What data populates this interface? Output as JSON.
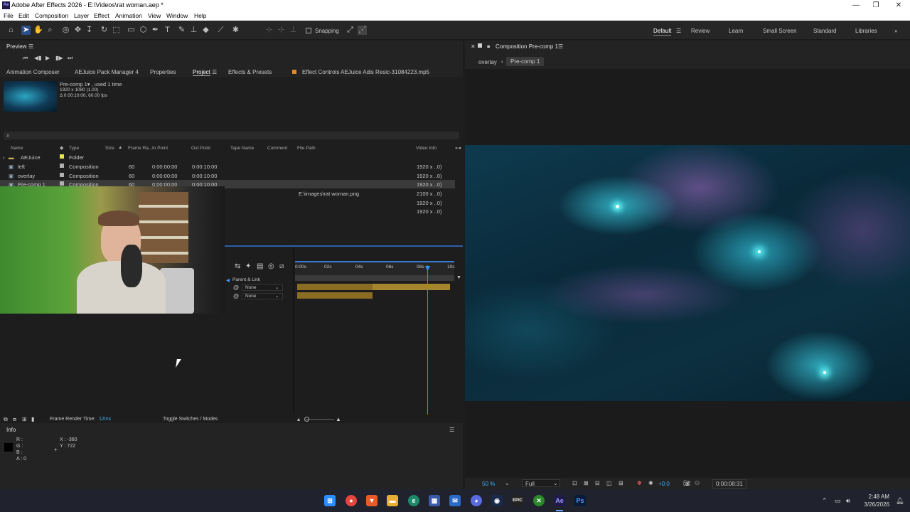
{
  "app": {
    "title": "Adobe After Effects 2026 - E:\\Videos\\rat woman.aep *",
    "logo": "Ae"
  },
  "menu": [
    "File",
    "Edit",
    "Composition",
    "Layer",
    "Effect",
    "Animation",
    "View",
    "Window",
    "Help"
  ],
  "toolbar": {
    "snapping_label": "Snapping"
  },
  "workspaces": {
    "default": "Default",
    "review": "Review",
    "learn": "Learn",
    "small_screen": "Small Screen",
    "standard": "Standard",
    "libraries": "Libraries"
  },
  "preview": {
    "title": "Preview"
  },
  "panel_tabs": {
    "animation_composer": "Animation Composer",
    "aejuice": "AEJuice Pack Manager 4",
    "properties": "Properties",
    "project": "Project",
    "effects": "Effects & Presets",
    "effect_controls": "Effect Controls AEJuice Adis Resic-31084223.mp5"
  },
  "project": {
    "selected_name": "Pre-comp 1▾ , used 1 time",
    "selected_size": "1920 x 1080 (1.00)",
    "selected_duration": "Δ 0:00:10:00, 60.00 fps",
    "search_icon": "search-icon",
    "columns": {
      "name": "Name",
      "type": "Type",
      "size": "Size",
      "frame_rate": "Frame Ra...",
      "in_point": "In Point",
      "out_point": "Out Point",
      "tape_name": "Tape Name",
      "comment": "Comment",
      "file_path": "File Path",
      "video_info": "Video Info"
    },
    "rows": [
      {
        "name": "AEJuice",
        "type": "Folder",
        "fps": "",
        "in": "",
        "out": "",
        "path": "",
        "video": "",
        "color": "#e6e64a"
      },
      {
        "name": "left",
        "type": "Composition",
        "fps": "60",
        "in": "0:00:00:00",
        "out": "0:00:10:00",
        "path": "",
        "video": "1920 x ..0)",
        "color": "#b0b0b0"
      },
      {
        "name": "overlay",
        "type": "Composition",
        "fps": "60",
        "in": "0:00:00:00",
        "out": "0:00:10:00",
        "path": "",
        "video": "1920 x ..0)",
        "color": "#b0b0b0"
      },
      {
        "name": "Pre-comp 1",
        "type": "Composition",
        "fps": "60",
        "in": "0:00:00:00",
        "out": "0:00:10:00",
        "path": "",
        "video": "1920 x ..0)",
        "color": "#b0b0b0"
      },
      {
        "name": "",
        "type": "",
        "fps": "",
        "in": "",
        "out": "",
        "path": "E:\\images\\rat woman.png",
        "video": "2100 x ..0)",
        "color": ""
      },
      {
        "name": "",
        "type": "",
        "fps": "",
        "in": "",
        "out": "",
        "path": "",
        "video": "1920 x ..0)",
        "color": ""
      },
      {
        "name": "",
        "type": "",
        "fps": "",
        "in": "",
        "out": "",
        "path": "",
        "video": "1920 x ..0)",
        "color": ""
      }
    ]
  },
  "timeline": {
    "ruler": [
      "0:00s",
      "02s",
      "04s",
      "06s",
      "08s",
      "10s"
    ],
    "parent_link": "Parent & Link",
    "layer_parents": [
      "None",
      "None"
    ],
    "frame_render_label": "Frame Render Time:",
    "frame_render_value": "12ms",
    "toggle_label": "Toggle Switches / Modes",
    "playhead_fraction": 0.86
  },
  "comp": {
    "tab": "Composition Pre-comp 1",
    "breadcrumb_parent": "overlay",
    "breadcrumb_current": "Pre-comp 1",
    "zoom": "50 %",
    "resolution": "Full",
    "exposure": "+0.0",
    "timecode": "0:00:08:31"
  },
  "info": {
    "title": "Info",
    "r": "R :",
    "g": "G :",
    "b": "B :",
    "a": "A : 0",
    "x": "X : -360",
    "y": "Y : 722"
  },
  "taskbar": {
    "time": "2:48 AM",
    "date": "3/26/2026"
  },
  "colors": {
    "accent": "#2d5fa8",
    "label_gold": "#b08a2a",
    "nebula_teal": "#2ec6d6",
    "nebula_purple": "#9a6ab8"
  }
}
